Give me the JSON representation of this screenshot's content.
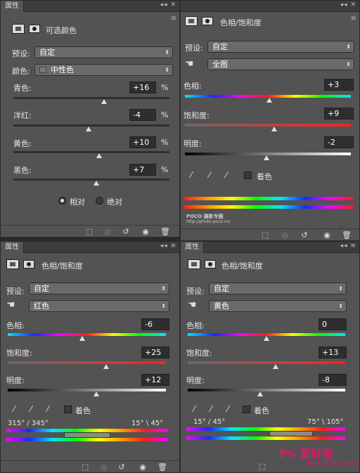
{
  "colors": {
    "accent_red": "#ff2020",
    "watermark_pink": "#e2156b"
  },
  "panel_tl": {
    "tab": "属性",
    "title": "可选颜色",
    "preset_label": "预设:",
    "preset_value": "自定",
    "color_label": "颜色:",
    "color_value": "中性色",
    "sliders": [
      {
        "label": "青色:",
        "value": "+16",
        "pct": "%",
        "level": 0.58
      },
      {
        "label": "洋红:",
        "value": "-4",
        "pct": "%",
        "level": 0.48
      },
      {
        "label": "黄色:",
        "value": "+10",
        "pct": "%",
        "level": 0.55
      },
      {
        "label": "黑色:",
        "value": "+7",
        "pct": "%",
        "level": 0.53
      }
    ],
    "radio_relative": "相对",
    "radio_absolute": "绝对"
  },
  "panel_tr": {
    "title": "色相/饱和度",
    "preset_label": "预设:",
    "preset_value": "自定",
    "range_value": "全图",
    "hue_label": "色相:",
    "hue_value": "+3",
    "hue_level": 0.51,
    "sat_label": "饱和度:",
    "sat_value": "+9",
    "sat_level": 0.54,
    "bri_label": "明度:",
    "bri_value": "-2",
    "bri_level": 0.49,
    "colorize_label": "着色",
    "watermark": "POCO 摄影专题",
    "watermark_url": "http://photo.poco.cn/"
  },
  "panel_bl": {
    "tab": "属性",
    "title": "色相/饱和度",
    "preset_label": "预设:",
    "preset_value": "自定",
    "range_value": "红色",
    "hue_label": "色相:",
    "hue_value": "-6",
    "hue_level": 0.47,
    "sat_label": "饱和度:",
    "sat_value": "+25",
    "sat_level": 0.62,
    "bri_label": "明度:",
    "bri_value": "+12",
    "bri_level": 0.56,
    "colorize_label": "着色",
    "range_left": "315° / 345°",
    "range_right": "15° \\ 45°"
  },
  "panel_br": {
    "tab": "属性",
    "title": "色相/饱和度",
    "preset_label": "预设:",
    "preset_value": "自定",
    "range_value": "黄色",
    "hue_label": "色相:",
    "hue_value": "0",
    "hue_level": 0.5,
    "sat_label": "饱和度:",
    "sat_value": "+13",
    "sat_level": 0.56,
    "bri_label": "明度:",
    "bri_value": "-8",
    "bri_level": 0.46,
    "colorize_label": "着色",
    "range_left": "15° / 45°",
    "range_right": "75° \\ 105°"
  },
  "watermark_site": "PS 爱好者",
  "watermark_site_url": "www.psahz.com"
}
